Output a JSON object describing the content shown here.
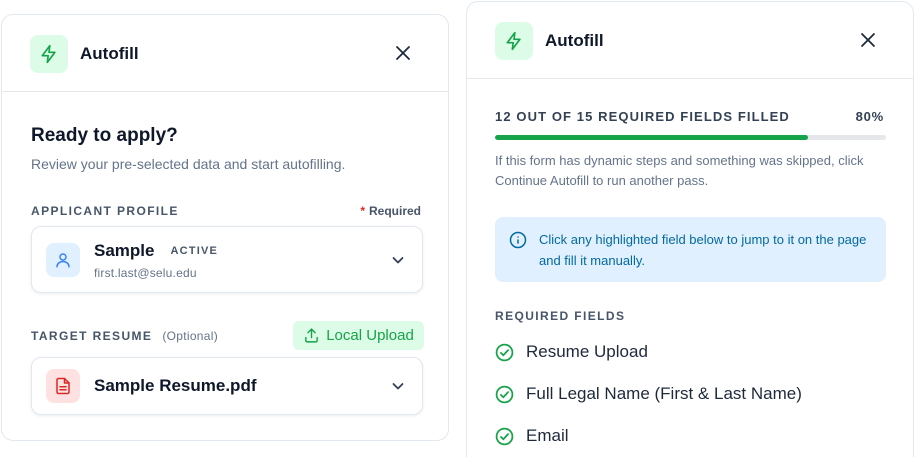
{
  "colors": {
    "accent": "#16a34a",
    "accent_bg": "#dcfce7",
    "info_bg": "#e0f0fe",
    "info_text": "#0369a1",
    "required_star": "#dc2626",
    "pdf_icon": "#dc2626",
    "pdf_bg": "#fee2e2",
    "profile_icon": "#3b82f6",
    "profile_bg": "#e0f0fe"
  },
  "left_panel": {
    "header": {
      "logo_icon": "lightning-bolt-icon",
      "title": "Autofill",
      "close_icon": "close-icon"
    },
    "heading": "Ready to apply?",
    "subheading": "Review your pre-selected data and start autofilling.",
    "applicant_profile": {
      "label": "APPLICANT PROFILE",
      "required_star": "*",
      "required_label": "Required",
      "icon": "user-icon",
      "name": "Sample",
      "status": "ACTIVE",
      "email": "first.last@selu.edu"
    },
    "target_resume": {
      "label": "TARGET RESUME",
      "optional_label": "(Optional)",
      "upload_icon": "upload-icon",
      "upload_label": "Local Upload",
      "file_icon": "pdf-file-icon",
      "file_name": "Sample Resume.pdf"
    }
  },
  "right_panel": {
    "header": {
      "logo_icon": "lightning-bolt-icon",
      "title": "Autofill",
      "close_icon": "close-icon"
    },
    "progress": {
      "label": "12 OUT OF 15 REQUIRED FIELDS FILLED",
      "percent_label": "80%",
      "filled": 12,
      "total": 15,
      "fraction": 0.8
    },
    "help_text": "If this form has dynamic steps and something was skipped, click Continue Autofill to run another pass.",
    "info": {
      "icon": "info-icon",
      "text": "Click any highlighted field below to jump to it on the page and fill it manually."
    },
    "required_fields": {
      "heading": "REQUIRED FIELDS",
      "items": [
        {
          "label": "Resume Upload",
          "icon": "check-circle-icon"
        },
        {
          "label": "Full Legal Name (First & Last Name)",
          "icon": "check-circle-icon"
        },
        {
          "label": "Email",
          "icon": "check-circle-icon"
        }
      ]
    }
  }
}
